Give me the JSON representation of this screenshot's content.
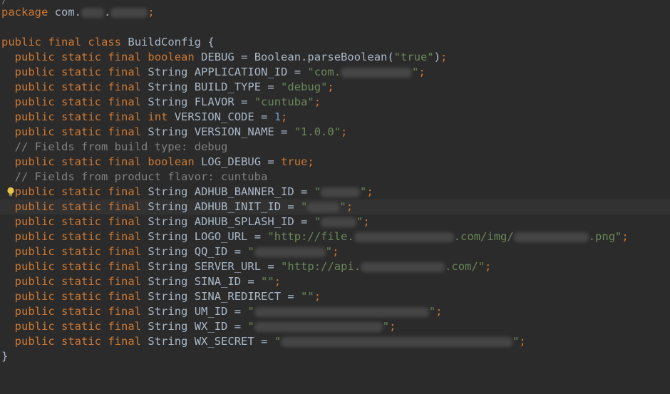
{
  "editor": {
    "top_fragment": "/",
    "package_keyword": "package",
    "package_prefix": "com.",
    "package_dot": ".",
    "semicolon": ";",
    "class_declaration": {
      "public": "public",
      "final": "final",
      "class": "class",
      "name": " BuildConfig {"
    },
    "closing_brace": "}",
    "modifier_tokens": [
      "public",
      "static",
      "final"
    ],
    "fields": [
      {
        "type": "boolean",
        "type_is_keyword": true,
        "name": "DEBUG",
        "value_prefix": "Boolean.parseBoolean(",
        "value_str": "\"true\"",
        "value_suffix": ")"
      },
      {
        "type": "String",
        "name": "APPLICATION_ID",
        "value_str_start": "\"com.",
        "value_str_end": "\"",
        "redacted": true
      },
      {
        "type": "String",
        "name": "BUILD_TYPE",
        "value_str": "\"debug\""
      },
      {
        "type": "String",
        "name": "FLAVOR",
        "value_str": "\"cuntuba\""
      },
      {
        "type": "int",
        "type_is_keyword": true,
        "name": "VERSION_CODE",
        "value_num": "1"
      },
      {
        "type": "String",
        "name": "VERSION_NAME",
        "value_str": "\"1.0.0\""
      }
    ],
    "comment_build_type": "// Fields from build type: debug",
    "log_debug": {
      "type": "boolean",
      "name": "LOG_DEBUG",
      "value_kw": "true"
    },
    "comment_flavor": "// Fields from product flavor: cuntuba",
    "flavor_fields": [
      {
        "name": "ADHUB_BANNER_ID",
        "start": "\"",
        "end": "\""
      },
      {
        "name": "ADHUB_INIT_ID",
        "start": "\"",
        "end": "\""
      },
      {
        "name": "ADHUB_SPLASH_ID",
        "start": "\"",
        "end": "\""
      },
      {
        "name": "LOGO_URL",
        "start": "\"http://file.",
        "mid": ".com/img/",
        "end": ".png\""
      },
      {
        "name": "QQ_ID",
        "start": "\"",
        "end": "\""
      },
      {
        "name": "SERVER_URL",
        "start": "\"http://api.",
        "end": ".com/\""
      },
      {
        "name": "SINA_ID",
        "start": "\"\"",
        "end": ""
      },
      {
        "name": "SINA_REDIRECT",
        "start": "\"\"",
        "end": ""
      },
      {
        "name": "UM_ID",
        "start": "\"",
        "end": "\""
      },
      {
        "name": "WX_ID",
        "start": "\"",
        "end": "\""
      },
      {
        "name": "WX_SECRET",
        "start": "\"",
        "end": "\""
      }
    ],
    "string_type": "String",
    "equals": " = ",
    "lightbulb_icon": "lightbulb-icon",
    "colors": {
      "background": "#2b2b2b",
      "keyword": "#cc7832",
      "string": "#6a8759",
      "number": "#6897bb",
      "comment": "#808080",
      "text": "#a9b7c6",
      "current_line": "#323232",
      "bulb": "#e8c34a"
    }
  }
}
